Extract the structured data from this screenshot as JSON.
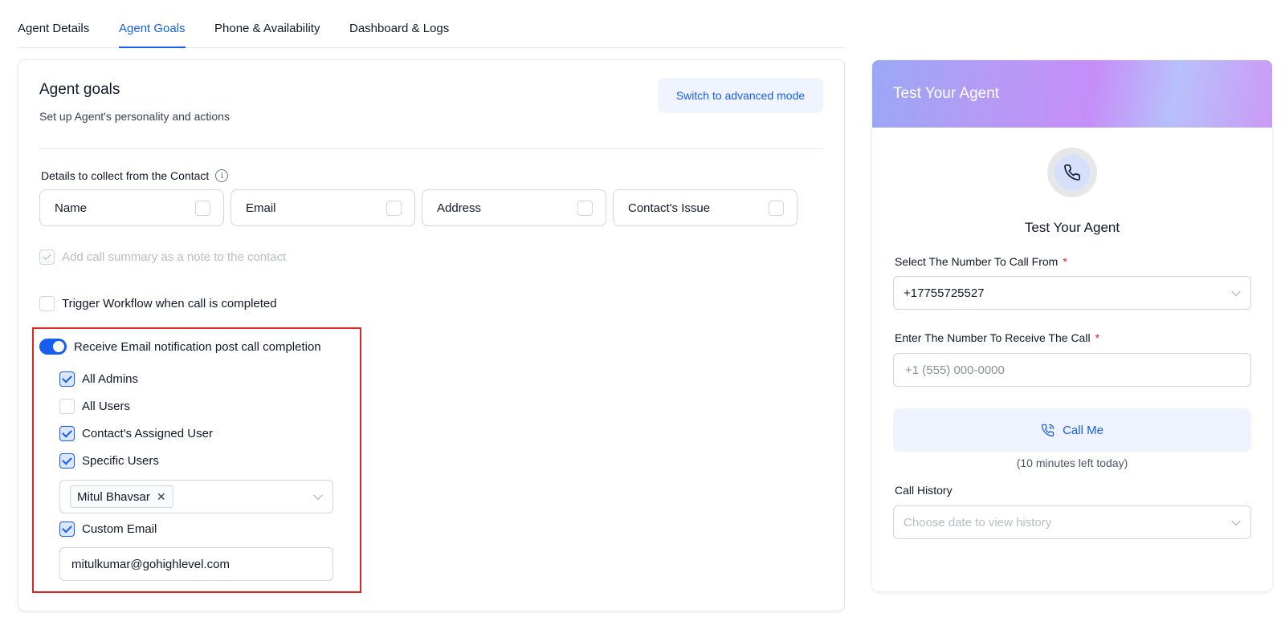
{
  "tabs": [
    {
      "label": "Agent Details"
    },
    {
      "label": "Agent Goals"
    },
    {
      "label": "Phone & Availability"
    },
    {
      "label": "Dashboard & Logs"
    }
  ],
  "goals": {
    "title": "Agent goals",
    "subtitle": "Set up Agent's personality and actions",
    "advanced_button": "Switch to advanced mode",
    "details_label": "Details to collect from the Contact",
    "fields": [
      {
        "label": "Name",
        "checked": false
      },
      {
        "label": "Email",
        "checked": false
      },
      {
        "label": "Address",
        "checked": false
      },
      {
        "label": "Contact's Issue",
        "checked": false
      }
    ],
    "call_summary_label": "Add call summary as a note to the contact",
    "trigger_workflow_label": "Trigger Workflow when call is completed",
    "email_notification": {
      "label": "Receive Email notification post call completion",
      "enabled": true,
      "options": [
        {
          "label": "All Admins",
          "checked": true
        },
        {
          "label": "All Users",
          "checked": false
        },
        {
          "label": "Contact's Assigned User",
          "checked": true
        },
        {
          "label": "Specific Users",
          "checked": true
        }
      ],
      "selected_user": "Mitul Bhavsar",
      "custom_email_label": "Custom Email",
      "custom_email_checked": true,
      "custom_email_value": "mitulkumar@gohighlevel.com"
    }
  },
  "test_panel": {
    "header_title": "Test Your Agent",
    "title": "Test Your Agent",
    "from_label": "Select The Number To Call From",
    "from_value": "+17755725527",
    "to_label": "Enter The Number To Receive The Call",
    "to_placeholder": "+1 (555) 000-0000",
    "call_button": "Call Me",
    "minutes_left": "(10 minutes left today)",
    "history_label": "Call History",
    "history_placeholder": "Choose date to view history",
    "required_mark": "*"
  },
  "colors": {
    "accent": "#155eef",
    "highlight_border": "#e02424",
    "required": "#e02424"
  }
}
